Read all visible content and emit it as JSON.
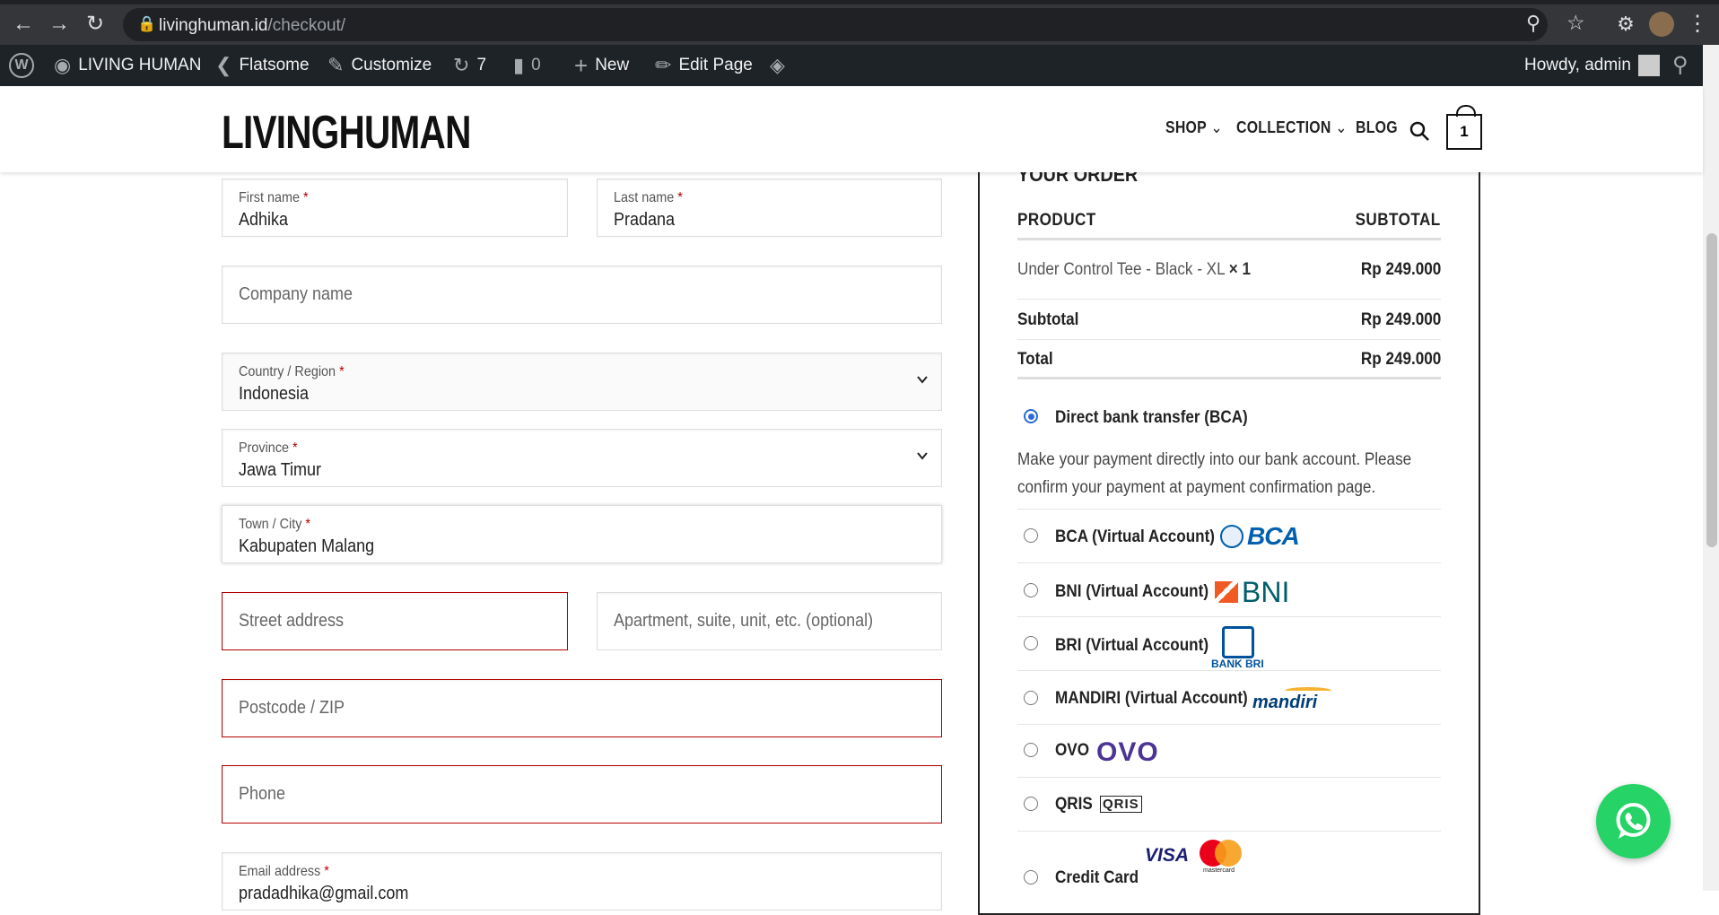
{
  "browser": {
    "url_host": "livinghuman.id",
    "url_path": "/checkout/"
  },
  "wp_admin_bar": {
    "site_name": "LIVING HUMAN",
    "flatsome": "Flatsome",
    "customize": "Customize",
    "updates_count": "7",
    "comments_count": "0",
    "new_label": "New",
    "edit_page": "Edit Page",
    "howdy": "Howdy, admin"
  },
  "header": {
    "logo": "LIVINGHUMAN",
    "nav": [
      "SHOP",
      "COLLECTION",
      "BLOG"
    ],
    "cart_count": "1"
  },
  "form": {
    "first_name_label": "First name",
    "first_name_value": "Adhika",
    "last_name_label": "Last name",
    "last_name_value": "Pradana",
    "company_placeholder": "Company name",
    "country_label": "Country / Region",
    "country_value": "Indonesia",
    "province_label": "Province",
    "province_value": "Jawa Timur",
    "city_label": "Town / City",
    "city_value": "Kabupaten Malang",
    "street_placeholder": "Street address",
    "apartment_placeholder": "Apartment, suite, unit, etc. (optional)",
    "postcode_placeholder": "Postcode / ZIP",
    "phone_placeholder": "Phone",
    "email_label": "Email address",
    "email_value": "pradadhika@gmail.com",
    "required_mark": "*"
  },
  "order": {
    "title": "YOUR ORDER",
    "col_product": "PRODUCT",
    "col_subtotal": "SUBTOTAL",
    "item_name": "Under Control Tee - Black - XL",
    "item_qty": "× 1",
    "item_price": "Rp 249.000",
    "subtotal_label": "Subtotal",
    "subtotal_value": "Rp 249.000",
    "total_label": "Total",
    "total_value": "Rp 249.000"
  },
  "payment": {
    "selected_method": "Direct bank transfer (BCA)",
    "selected_desc": "Make your payment directly into our bank account. Please confirm your payment at payment confirmation page.",
    "methods": [
      "BCA (Virtual Account)",
      "BNI (Virtual Account)",
      "BRI (Virtual Account)",
      "MANDIRI (Virtual Account)",
      "OVO",
      "QRIS",
      "Credit Card"
    ],
    "logos": {
      "bca": "BCA",
      "bni": "BNI",
      "bri": "BANK BRI",
      "mandiri": "mandiri",
      "ovo": "OVO",
      "qris": "QRIS",
      "visa": "VISA",
      "mastercard": "mastercard"
    }
  },
  "colors": {
    "error_border": "#b20000",
    "radio_selected": "#2b6cd4",
    "whatsapp": "#25d366",
    "wp_bar": "#1d2327"
  }
}
